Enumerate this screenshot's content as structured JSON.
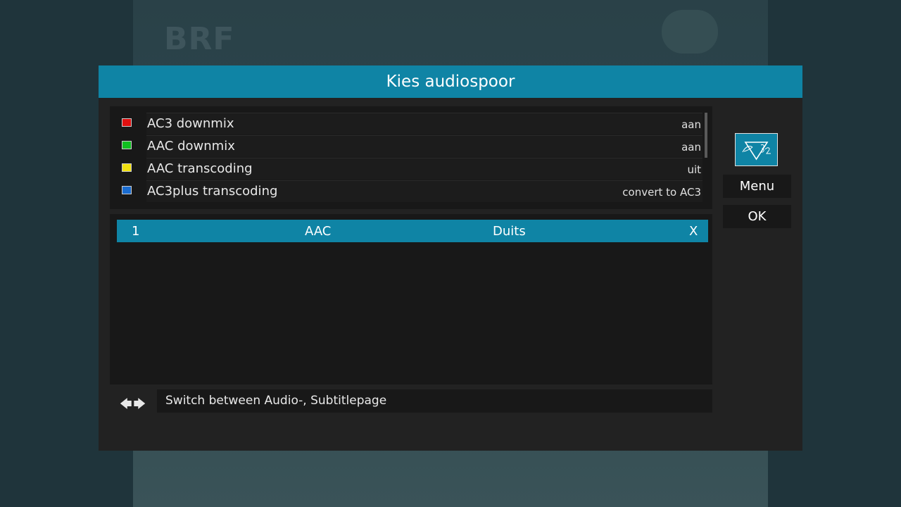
{
  "background": {
    "channel_logo": "BRF"
  },
  "dialog": {
    "title": "Kies audiospoor",
    "options": [
      {
        "key_color": "#e01010",
        "label": "AC3 downmix",
        "value": "aan"
      },
      {
        "key_color": "#10c020",
        "label": "AAC downmix",
        "value": "aan"
      },
      {
        "key_color": "#f0e010",
        "label": "AAC transcoding",
        "value": "uit"
      },
      {
        "key_color": "#1a6cd0",
        "label": "AC3plus transcoding",
        "value": "convert to AC3"
      }
    ],
    "tracks": [
      {
        "number": "1",
        "codec": "AAC",
        "language": "Duits",
        "selected_mark": "X"
      }
    ],
    "hint": {
      "arrows": "🡄🡆",
      "text": "Switch between Audio-, Subtitlepage"
    },
    "side": {
      "logo_icon": "pure2-logo-icon",
      "menu_label": "Menu",
      "ok_label": "OK"
    }
  },
  "colors": {
    "accent": "#0f84a5",
    "panel": "#181818",
    "dialog": "#222222"
  }
}
